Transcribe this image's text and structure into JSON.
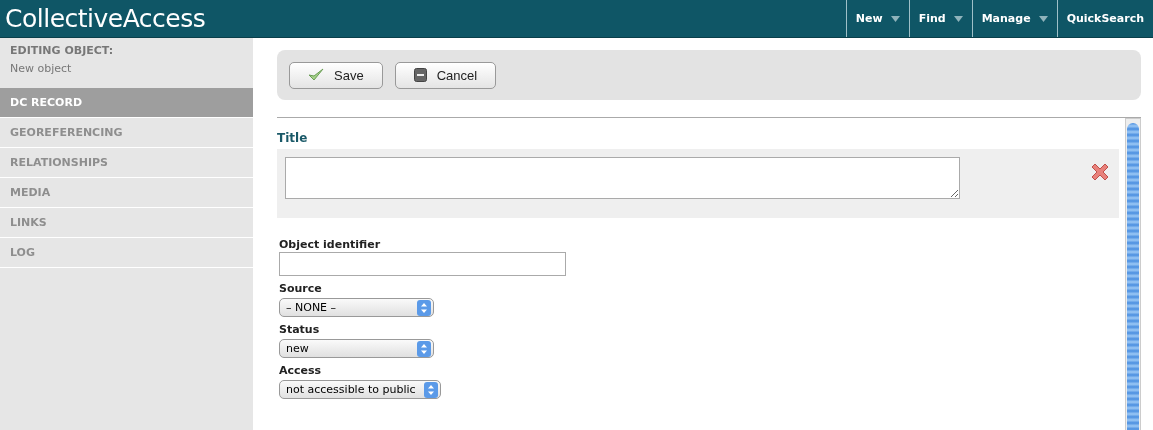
{
  "header": {
    "logo": "CollectiveAccess",
    "menu": [
      {
        "label": "New",
        "kind": "dropdown"
      },
      {
        "label": "Find",
        "kind": "dropdown"
      },
      {
        "label": "Manage",
        "kind": "dropdown"
      },
      {
        "label": "QuickSearch",
        "kind": "link"
      }
    ]
  },
  "sidebar": {
    "heading": "EDITING OBJECT:",
    "subheading": "New object",
    "items": [
      {
        "label": "DC RECORD",
        "selected": true
      },
      {
        "label": "GEOREFERENCING",
        "selected": false
      },
      {
        "label": "RELATIONSHIPS",
        "selected": false
      },
      {
        "label": "MEDIA",
        "selected": false
      },
      {
        "label": "LINKS",
        "selected": false
      },
      {
        "label": "LOG",
        "selected": false
      }
    ]
  },
  "toolbar": {
    "buttons": [
      {
        "label": "Save",
        "kind": "save"
      },
      {
        "label": "Cancel",
        "kind": "cancel"
      }
    ]
  },
  "form": {
    "title_label": "Title",
    "fields": [
      {
        "kind": "text",
        "label": "Object identifier"
      },
      {
        "kind": "select",
        "label": "Source",
        "value": "– NONE –"
      },
      {
        "kind": "select",
        "label": "Status",
        "value": "new"
      },
      {
        "kind": "select",
        "label": "Access",
        "value": "not accessible to public"
      }
    ]
  }
}
